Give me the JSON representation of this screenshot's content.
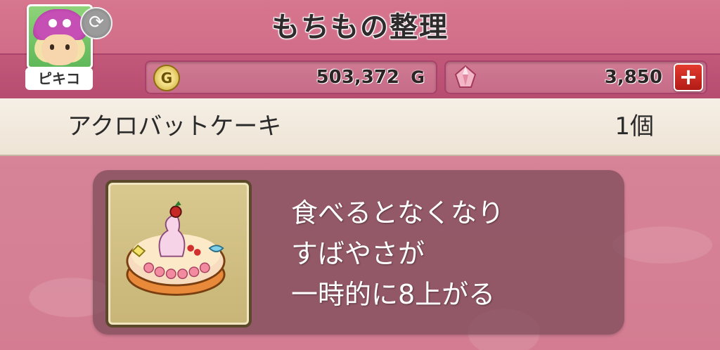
{
  "header": {
    "title": "もちもの整理",
    "character_name": "ピキコ",
    "swap_icon": "refresh-icon"
  },
  "currency": {
    "gold_amount": "503,372",
    "gold_unit": "G",
    "gold_icon": "gold-coin-icon",
    "gem_amount": "3,850",
    "gem_icon": "gem-icon",
    "plus_label": "+"
  },
  "item": {
    "name": "アクロバットケーキ",
    "count": "1個",
    "icon": "cake-icon",
    "description": [
      "食べるとなくなり",
      "すばやさが",
      "一時的に8上がる"
    ]
  },
  "colors": {
    "header": "#cf6a86",
    "background": "#d87e94",
    "item_strip": "#f6efe5",
    "panel": "#7a4a56",
    "plus_button": "#d42e24"
  }
}
